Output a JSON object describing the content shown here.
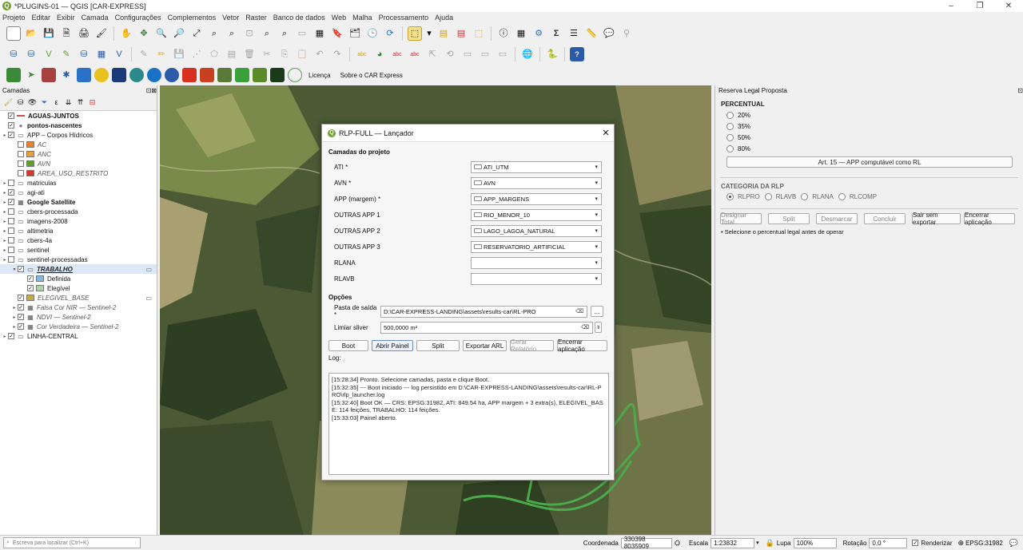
{
  "window": {
    "title": "*PLUGINS-01 — QGIS [CAR-EXPRESS]"
  },
  "menu": [
    "Projeto",
    "Editar",
    "Exibir",
    "Camada",
    "Configurações",
    "Complementos",
    "Vetor",
    "Raster",
    "Banco de dados",
    "Web",
    "Malha",
    "Processamento",
    "Ajuda"
  ],
  "toolbar3": {
    "licenca": "Licença",
    "sobre": "Sobre o CAR Express"
  },
  "layers_panel": {
    "title": "Camadas",
    "layers": [
      {
        "name": "AGUAS-JUNTOS",
        "bold": true,
        "checked": true,
        "level": 0,
        "icon": "line",
        "color": "#c85050"
      },
      {
        "name": "pontos-nascentes",
        "bold": true,
        "checked": true,
        "level": 0,
        "icon": "point",
        "color": "#8a6fa8"
      },
      {
        "name": "APP – Corpos Hídricos",
        "checked": true,
        "level": 0,
        "expand": true,
        "icon": "group"
      },
      {
        "name": "AC",
        "italic": true,
        "checked": false,
        "level": 1,
        "icon": "poly",
        "color": "#e8832a"
      },
      {
        "name": "ANC",
        "italic": true,
        "checked": false,
        "level": 1,
        "icon": "poly",
        "color": "#e8a23c"
      },
      {
        "name": "AVN",
        "italic": true,
        "checked": false,
        "level": 1,
        "icon": "poly",
        "color": "#5aa02c"
      },
      {
        "name": "AREA_USO_RESTRITO",
        "italic": true,
        "checked": false,
        "level": 1,
        "icon": "poly",
        "color": "#d9342b"
      },
      {
        "name": "matriculas",
        "checked": false,
        "level": 0,
        "expand": true,
        "icon": "group"
      },
      {
        "name": "agi-ati",
        "checked": true,
        "level": 0,
        "expand": true,
        "icon": "group"
      },
      {
        "name": "Google Satellite",
        "bold": true,
        "checked": true,
        "level": 0,
        "expand": true,
        "icon": "raster"
      },
      {
        "name": "cbers-processada",
        "checked": false,
        "level": 0,
        "expand": true,
        "icon": "group"
      },
      {
        "name": "imagens-2008",
        "checked": false,
        "level": 0,
        "expand": true,
        "icon": "group"
      },
      {
        "name": "altimetria",
        "checked": false,
        "level": 0,
        "expand": true,
        "icon": "group"
      },
      {
        "name": "cbers-4a",
        "checked": false,
        "level": 0,
        "expand": true,
        "icon": "group"
      },
      {
        "name": "sentinel",
        "checked": false,
        "level": 0,
        "expand": true,
        "icon": "group"
      },
      {
        "name": "sentinel-processadas",
        "checked": false,
        "level": 0,
        "expand": true,
        "icon": "group"
      },
      {
        "name": "TRABALHO",
        "bold": true,
        "italic": true,
        "underline": true,
        "checked": true,
        "level": 1,
        "expand": true,
        "icon": "group",
        "selected": true
      },
      {
        "name": "Definida",
        "checked": true,
        "level": 2,
        "icon": "poly",
        "color": "#7fb8e0"
      },
      {
        "name": "Elegível",
        "checked": true,
        "level": 2,
        "icon": "poly",
        "color": "#a9d8a0"
      },
      {
        "name": "ELEGIVEL_BASE",
        "italic": true,
        "checked": true,
        "level": 1,
        "icon": "poly",
        "color": "#c8a84a"
      },
      {
        "name": "Falsa Cor NIR — Sentinel-2",
        "italic": true,
        "checked": true,
        "level": 1,
        "expand": true,
        "icon": "raster"
      },
      {
        "name": "NDVI — Sentinel-2",
        "italic": true,
        "checked": true,
        "level": 1,
        "expand": true,
        "icon": "raster"
      },
      {
        "name": "Cor Verdadeira — Sentinel-2",
        "italic": true,
        "checked": true,
        "level": 1,
        "expand": true,
        "icon": "raster"
      },
      {
        "name": "LINHA-CENTRAL",
        "checked": true,
        "level": 0,
        "expand": true,
        "icon": "group"
      }
    ]
  },
  "dialog": {
    "title": "RLP-FULL — Lançador",
    "group_camadas": "Camadas do projeto",
    "fields": [
      {
        "label": "ATI *",
        "value": "ATI_UTM"
      },
      {
        "label": "AVN *",
        "value": "AVN"
      },
      {
        "label": "APP (margem) *",
        "value": "APP_MARGENS"
      },
      {
        "label": "OUTRAS APP 1",
        "value": "RIO_MENOR_10"
      },
      {
        "label": "OUTRAS APP 2",
        "value": "LAGO_LAGOA_NATURAL"
      },
      {
        "label": "OUTRAS APP 3",
        "value": "RESERVATORIO_ARTIFICIAL"
      },
      {
        "label": "RLANA",
        "value": ""
      },
      {
        "label": "RLAVB",
        "value": ""
      }
    ],
    "group_opcoes": "Opções",
    "pasta_label": "Pasta de saída *",
    "pasta_value": "D:\\CAR-EXPRESS-LANDING\\assets\\results-car\\RL-PRO",
    "browse": "...",
    "limiar_label": "Limiar sliver",
    "limiar_value": "500,0000 m²",
    "buttons": [
      "Boot",
      "Abrir Painel",
      "Split",
      "Exportar ARL",
      "Gerar Relatório",
      "Encerrar aplicação"
    ],
    "log_label": "Log:",
    "log": [
      "[15:28:34] Pronto. Selecione camadas, pasta e clique Boot.",
      "[15:32:35] --- Boot iniciado --- log persistido em D:\\CAR-EXPRESS-LANDING\\assets\\results-car\\RL-PRO\\rlp_launcher.log",
      "[15:32:40] Boot OK — CRS: EPSG:31982, ATI: 849.54 ha, APP margem + 3 extra(s), ELEGIVEL_BASE: 114 feições, TRABALHO: 114 feições.",
      "[15:33:03] Painel aberto."
    ]
  },
  "right_panel": {
    "title": "Reserva Legal Proposta",
    "percentual_label": "PERCENTUAL",
    "percentuais": [
      "20%",
      "35%",
      "50%",
      "80%"
    ],
    "art_button": "Art. 15 — APP computável como RL",
    "categoria_label": "CATEGORIA DA RLP",
    "categorias": [
      "RLPRO",
      "RLAVB",
      "RLANA",
      "RLCOMP"
    ],
    "buttons": [
      "Designar Total",
      "Split",
      "Desmarcar",
      "Concluir",
      "Sair sem exportar",
      "Encerrar aplicação"
    ],
    "hint": "• Selecione o percentual legal antes de operar"
  },
  "statusbar": {
    "search_placeholder": "Escreva para localizar (Ctrl+K)",
    "coordenada_label": "Coordenada",
    "coordenada": "330398  8035909",
    "escala_label": "Escala",
    "escala": "1:23832",
    "lupa_label": "Lupa",
    "lupa": "100%",
    "rotacao_label": "Rotação",
    "rotacao": "0,0 °",
    "renderizar_label": "Renderizar",
    "epsg": "EPSG:31982"
  }
}
